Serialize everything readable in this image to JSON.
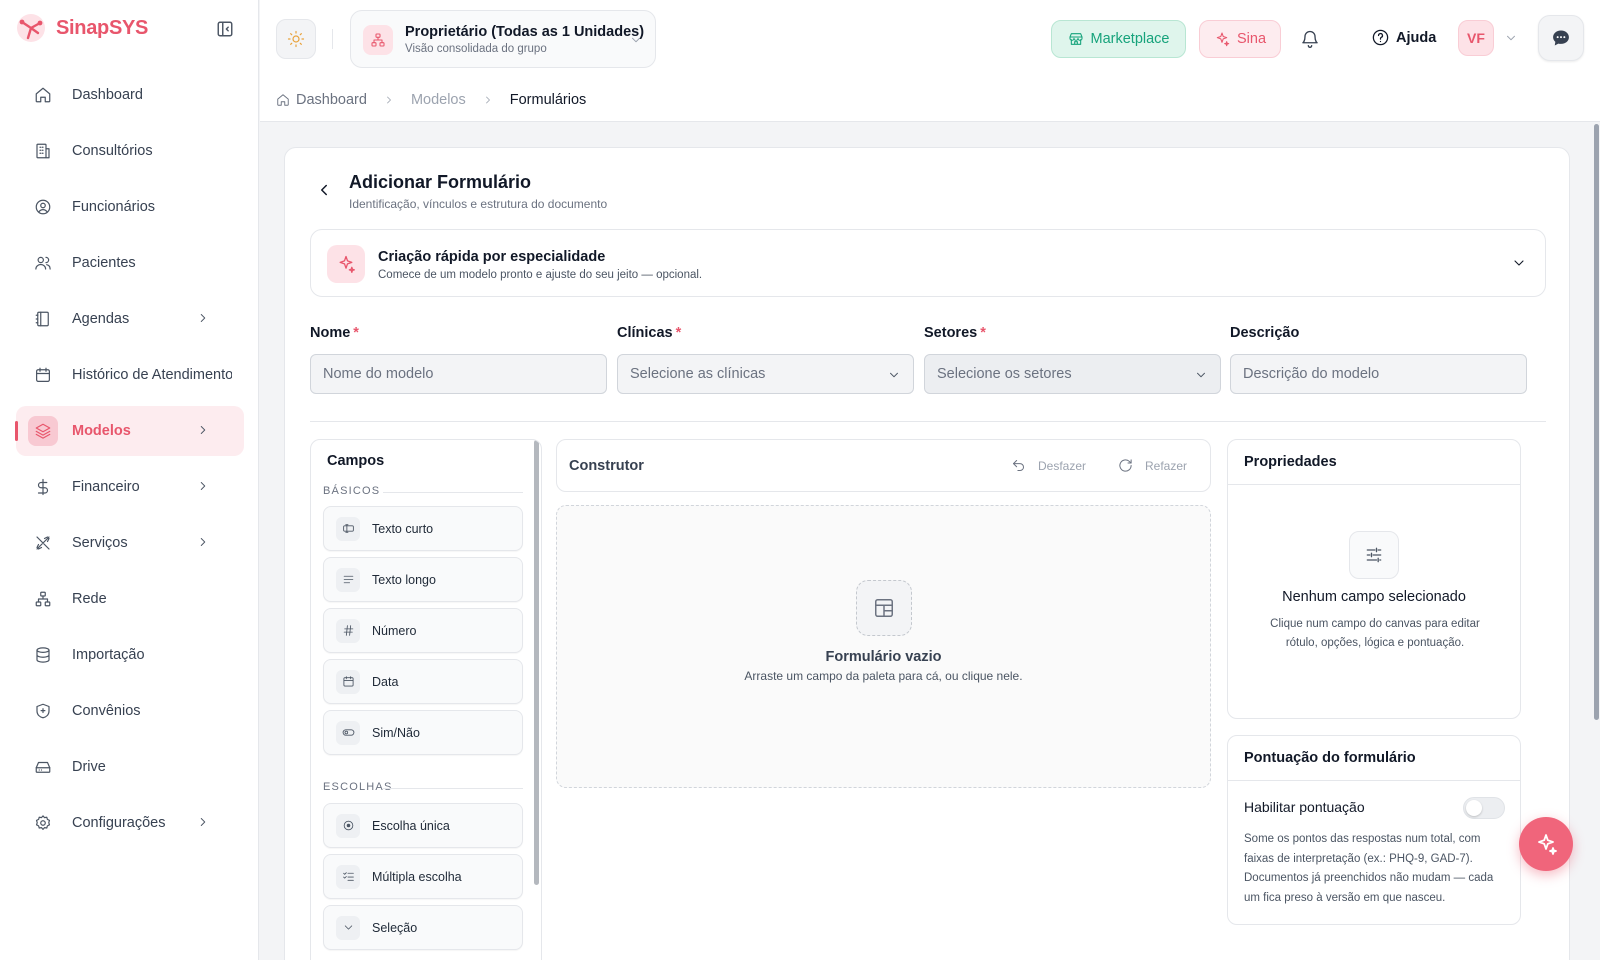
{
  "brand": {
    "name_a": "Sinap",
    "name_b": "SYS"
  },
  "sidebar": {
    "items": [
      {
        "label": "Dashboard"
      },
      {
        "label": "Consultórios"
      },
      {
        "label": "Funcionários"
      },
      {
        "label": "Pacientes"
      },
      {
        "label": "Agendas"
      },
      {
        "label": "Histórico de Atendimento"
      },
      {
        "label": "Modelos"
      },
      {
        "label": "Financeiro"
      },
      {
        "label": "Serviços"
      },
      {
        "label": "Rede"
      },
      {
        "label": "Importação"
      },
      {
        "label": "Convênios"
      },
      {
        "label": "Drive"
      },
      {
        "label": "Configurações"
      }
    ]
  },
  "topbar": {
    "unit_title": "Proprietário (Todas as 1 Unidades)",
    "unit_sub": "Visão consolidada do grupo",
    "marketplace": "Marketplace",
    "sina": "Sina",
    "help": "Ajuda",
    "avatar": "VF"
  },
  "breadcrumb": {
    "home": "Dashboard",
    "mid": "Modelos",
    "current": "Formulários"
  },
  "page": {
    "title": "Adicionar Formulário",
    "subtitle": "Identificação, vínculos e estrutura do documento",
    "quick_title": "Criação rápida por especialidade",
    "quick_sub": "Comece de um modelo pronto e ajuste do seu jeito — opcional."
  },
  "form": {
    "name_label": "Nome",
    "name_placeholder": "Nome do modelo",
    "clinics_label": "Clínicas",
    "clinics_placeholder": "Selecione as clínicas",
    "sectors_label": "Setores",
    "sectors_placeholder": "Selecione os setores",
    "desc_label": "Descrição",
    "desc_placeholder": "Descrição do modelo",
    "required_mark": "*"
  },
  "palette": {
    "title": "Campos",
    "group_basic": "BÁSICOS",
    "group_choices": "ESCOLHAS",
    "basic": [
      {
        "label": "Texto curto",
        "icon": "text-cursor-icon"
      },
      {
        "label": "Texto longo",
        "icon": "align-left-icon"
      },
      {
        "label": "Número",
        "icon": "hash-icon"
      },
      {
        "label": "Data",
        "icon": "calendar-icon"
      },
      {
        "label": "Sim/Não",
        "icon": "toggle-icon"
      }
    ],
    "choices": [
      {
        "label": "Escolha única",
        "icon": "radio-icon"
      },
      {
        "label": "Múltipla escolha",
        "icon": "checklist-icon"
      },
      {
        "label": "Seleção",
        "icon": "chevron-down-icon"
      }
    ]
  },
  "builder": {
    "title": "Construtor",
    "undo": "Desfazer",
    "redo": "Refazer",
    "empty_title": "Formulário vazio",
    "empty_sub": "Arraste um campo da paleta para cá, ou clique nele."
  },
  "properties": {
    "title": "Propriedades",
    "empty_title": "Nenhum campo selecionado",
    "empty_sub": "Clique num campo do canvas para editar rótulo, opções, lógica e pontuação."
  },
  "scoring": {
    "title": "Pontuação do formulário",
    "toggle_label": "Habilitar pontuação",
    "enabled": false,
    "desc": "Some os pontos das respostas num total, com faixas de interpretação (ex.: PHQ-9, GAD-7). Documentos já preenchidos não mudam — cada um fica preso à versão em que nasceu."
  },
  "colors": {
    "accent": "#e8566c",
    "market": "#16a37b"
  }
}
